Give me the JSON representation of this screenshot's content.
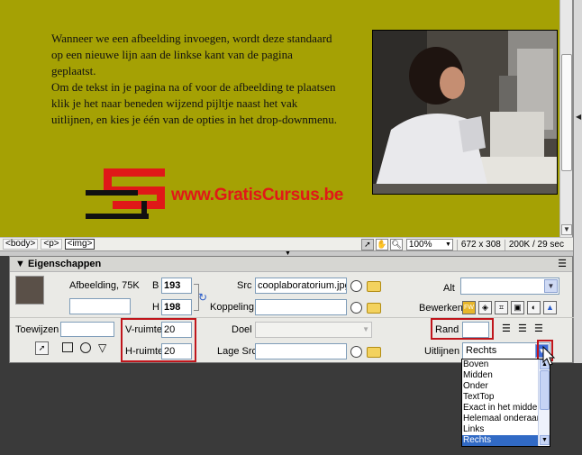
{
  "document": {
    "paragraph1": "Wanneer we een afbeelding invoegen, wordt deze standaard op een nieuwe lijn aan de linkse kant van de pagina geplaatst.",
    "paragraph2": "Om de tekst in je pagina na of voor de afbeelding te plaatsen klik je het naar beneden wijzend pijltje naast het vak uitlijnen, en kies je één van de opties in het drop-downmenu.",
    "logo_text": "www.GratisCursus.be"
  },
  "statusbar": {
    "tags": [
      "<body>",
      "<p>",
      "<img>"
    ],
    "zoom": "100%",
    "dimensions": "672 x 308",
    "size": "200K / 29 sec"
  },
  "properties": {
    "title": "Eigenschappen",
    "image_label": "Afbeelding, 75K",
    "b_label": "B",
    "b_value": "193",
    "h_label": "H",
    "h_value": "198",
    "src_label": "Src",
    "src_value": "cooplaboratorium.jpg",
    "koppeling_label": "Koppeling",
    "koppeling_value": "",
    "alt_label": "Alt",
    "alt_value": "",
    "bewerken_label": "Bewerken",
    "toewijzen_label": "Toewijzen",
    "v_ruimte_label": "V-ruimte",
    "v_ruimte_value": "20",
    "h_ruimte_label": "H-ruimte",
    "h_ruimte_value": "20",
    "doel_label": "Doel",
    "lage_src_label": "Lage Src",
    "rand_label": "Rand",
    "rand_value": "",
    "uitlijnen_label": "Uitlijnen",
    "uitlijnen_value": "Rechts"
  },
  "align_options": [
    "Boven",
    "Midden",
    "Onder",
    "TextTop",
    "Exact in het midde",
    "Helemaal onderaan",
    "Links",
    "Rechts"
  ],
  "colors": {
    "page_bg": "#a5a104",
    "logo_red": "#e01818",
    "highlight": "#c0161c",
    "selection": "#316ac5"
  },
  "icons": [
    "select-arrow-icon",
    "hand-icon",
    "zoom-icon",
    "folder-icon",
    "point-to-file-icon",
    "fireworks-edit-icon",
    "crop-icon",
    "resample-icon",
    "brightness-icon",
    "sharpen-icon",
    "rect-hotspot-icon",
    "circle-hotspot-icon",
    "polygon-hotspot-icon",
    "align-left-icon",
    "align-center-icon",
    "align-right-icon",
    "reset-size-icon",
    "mouse-cursor-icon"
  ]
}
